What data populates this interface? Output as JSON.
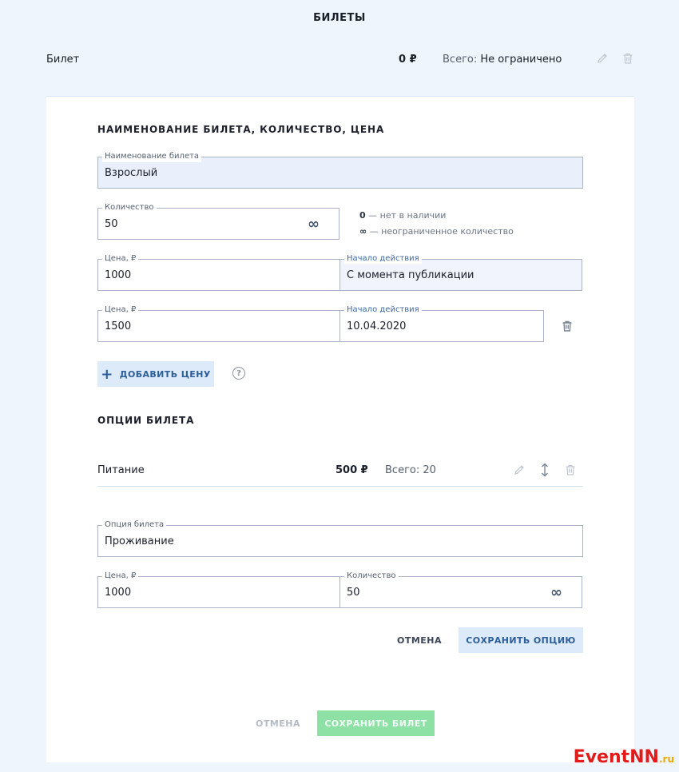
{
  "page": {
    "title": "БИЛЕТЫ"
  },
  "ticket_row": {
    "name": "Билет",
    "price": "0 ₽",
    "total_label": "Всего:",
    "total_value": "Не ограничено"
  },
  "section_ticket": {
    "title": "НАИМЕНОВАНИЕ БИЛЕТА, КОЛИЧЕСТВО, ЦЕНА"
  },
  "fields": {
    "name": {
      "label": "Наименование билета",
      "value": "Взрослый"
    },
    "quantity": {
      "label": "Количество",
      "value": "50",
      "infinity": "∞"
    },
    "price1": {
      "label": "Цена, ₽",
      "value": "1000"
    },
    "start1": {
      "label": "Начало действия",
      "value": "С момента публикации"
    },
    "price2": {
      "label": "Цена, ₽",
      "value": "1500"
    },
    "start2": {
      "label": "Начало действия",
      "value": "10.04.2020"
    }
  },
  "hints": {
    "zero_key": "0",
    "zero_text": "— нет в наличии",
    "inf_key": "∞",
    "inf_text": "— неограниченное количество"
  },
  "add_price": {
    "plus": "+",
    "label": "ДОБАВИТЬ ЦЕНУ",
    "help": "?"
  },
  "section_options": {
    "title": "ОПЦИИ БИЛЕТА"
  },
  "option_row": {
    "name": "Питание",
    "price": "500 ₽",
    "total": "Всего: 20"
  },
  "option_form": {
    "option": {
      "label": "Опция билета",
      "value": "Проживание"
    },
    "price": {
      "label": "Цена, ₽",
      "value": "1000"
    },
    "quantity": {
      "label": "Количество",
      "value": "50",
      "infinity": "∞"
    }
  },
  "option_buttons": {
    "cancel": "ОТМЕНА",
    "save": "СОХРАНИТЬ ОПЦИЮ"
  },
  "main_buttons": {
    "cancel": "ОТМЕНА",
    "save": "СОХРАНИТЬ БИЛЕТ"
  },
  "watermark": {
    "main": "EventNN",
    "suffix": ".ru"
  },
  "colors": {
    "accent": "#2c5e99",
    "save_green": "#8de1a5",
    "logo_red": "#e31a1a",
    "background": "#eef5fd"
  },
  "icons": [
    "pencil-icon",
    "trash-icon",
    "sort-arrows-icon",
    "help-icon",
    "plus-icon",
    "infinity-icon"
  ]
}
